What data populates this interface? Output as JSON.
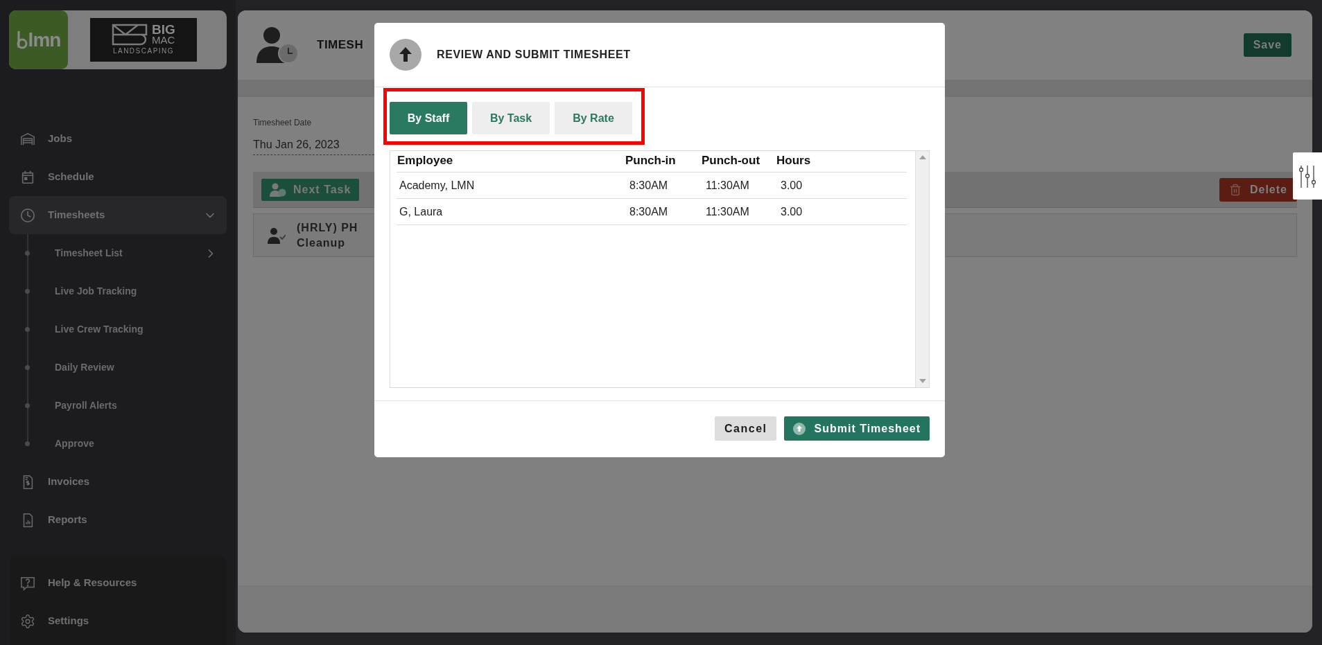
{
  "sidebar": {
    "logo": {
      "app": "lmn",
      "company": [
        "BIG",
        "MAC",
        "LANDSCAPING"
      ]
    },
    "items": [
      {
        "label": "Jobs",
        "selected": false
      },
      {
        "label": "Schedule",
        "selected": false
      },
      {
        "label": "Timesheets",
        "selected": true,
        "expanded": true,
        "children": [
          {
            "label": "Timesheet List",
            "submenu": true
          },
          {
            "label": "Live Job Tracking",
            "submenu": false
          },
          {
            "label": "Live Crew Tracking",
            "submenu": false
          },
          {
            "label": "Daily Review",
            "submenu": false
          },
          {
            "label": "Payroll Alerts",
            "submenu": false
          },
          {
            "label": "Approve",
            "submenu": false
          }
        ]
      },
      {
        "label": "Invoices",
        "selected": false
      },
      {
        "label": "Reports",
        "selected": false
      }
    ],
    "footer_items": [
      {
        "label": "Help & Resources"
      },
      {
        "label": "Settings"
      }
    ]
  },
  "page": {
    "title": "TIMESH",
    "save_button": "Save",
    "date_field": {
      "label": "Timesheet Date",
      "value": "Thu Jan 26, 2023"
    },
    "next_task_button": "Next Task",
    "delete_button": "Delete",
    "task_row": [
      "(HRLY) PH",
      "Cleanup"
    ]
  },
  "dialog": {
    "title": "REVIEW AND SUBMIT TIMESHEET",
    "tabs": [
      {
        "label": "By Staff",
        "selected": true
      },
      {
        "label": "By Task",
        "selected": false
      },
      {
        "label": "By Rate",
        "selected": false
      }
    ],
    "table": {
      "columns": [
        "Employee",
        "Punch-in",
        "Punch-out",
        "Hours"
      ],
      "rows": [
        [
          "Academy, LMN",
          "8:30AM",
          "11:30AM",
          "3.00"
        ],
        [
          "G, Laura",
          "8:30AM",
          "11:30AM",
          "3.00"
        ]
      ]
    },
    "cancel_button": "Cancel",
    "submit_button": "Submit Timesheet"
  }
}
